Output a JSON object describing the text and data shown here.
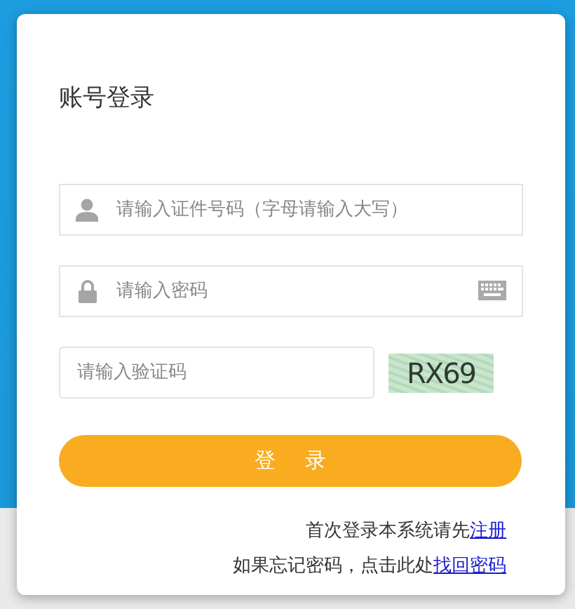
{
  "title": "账号登录",
  "fields": [
    {
      "kind": "user",
      "placeholder": "请输入证件号码（字母请输入大写）"
    },
    {
      "kind": "password",
      "placeholder": "请输入密码"
    }
  ],
  "captcha": {
    "placeholder": "请输入验证码",
    "image_text": "RX69"
  },
  "login_button": "登 录",
  "notes": [
    {
      "text": "首次登录本系统请先",
      "link": "注册"
    },
    {
      "text": "如果忘记密码，点击此处",
      "link": "找回密码"
    }
  ]
}
